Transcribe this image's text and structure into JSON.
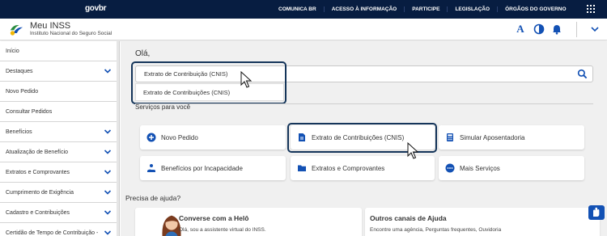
{
  "gov_bar": {
    "logo": "govbr",
    "links": [
      "COMUNICA BR",
      "ACESSO À INFORMAÇÃO",
      "PARTICIPE",
      "LEGISLAÇÃO",
      "ÓRGÃOS DO GOVERNO"
    ]
  },
  "header": {
    "app_name": "Meu INSS",
    "subtitle": "Instituto Nacional do Seguro Social",
    "font_icon_label": "A"
  },
  "sidebar": {
    "items": [
      {
        "label": "Início",
        "expandable": false
      },
      {
        "label": "Destaques",
        "expandable": true
      },
      {
        "label": "Novo Pedido",
        "expandable": false
      },
      {
        "label": "Consultar Pedidos",
        "expandable": false
      },
      {
        "label": "Benefícios",
        "expandable": true
      },
      {
        "label": "Atualização de Benefício",
        "expandable": true
      },
      {
        "label": "Extratos e Comprovantes",
        "expandable": true
      },
      {
        "label": "Cumprimento de Exigência",
        "expandable": true
      },
      {
        "label": "Cadastro e Contribuições",
        "expandable": true
      },
      {
        "label": "Certidão de Tempo de Contribuição -",
        "expandable": true
      }
    ]
  },
  "main": {
    "greeting": "Olá,",
    "search": {
      "value": "Extrato de Contribuição (CNIS)",
      "suggestion": "Extrato de Contribuições (CNIS)"
    },
    "services_title": "Serviços para você",
    "services": [
      {
        "label": "Novo Pedido",
        "icon": "plus-circle-icon"
      },
      {
        "label": "Extrato de Contribuições (CNIS)",
        "icon": "document-icon"
      },
      {
        "label": "Simular Aposentadoria",
        "icon": "calculator-icon"
      },
      {
        "label": "Benefícios por Incapacidade",
        "icon": "hand-person-icon"
      },
      {
        "label": "Extratos e Comprovantes",
        "icon": "folder-icon"
      },
      {
        "label": "Mais Serviços",
        "icon": "ellipsis-circle-icon"
      }
    ],
    "help_title": "Precisa de ajuda?",
    "help_panels": [
      {
        "title": "Converse com a Helô",
        "subtitle": "Olá, sou a assistente virtual do INSS."
      },
      {
        "title": "Outros canais de Ajuda",
        "subtitle": "Encontre uma agência, Perguntas frequentes, Ouvidoria"
      }
    ]
  },
  "colors": {
    "gov_blue": "#071d41",
    "accent": "#1351b4",
    "focus": "#15355a"
  }
}
